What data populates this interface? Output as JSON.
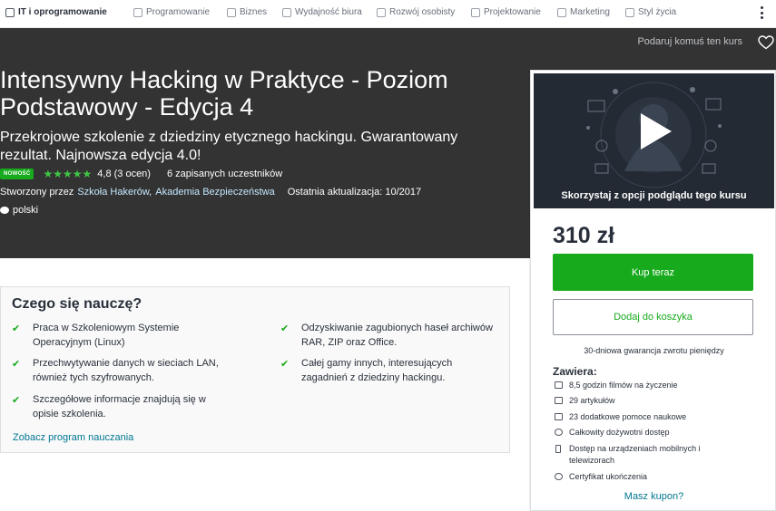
{
  "nav": {
    "home": "IT i oprogramowanie",
    "items": [
      "Programowanie",
      "Biznes",
      "Wydajność biura",
      "Rozwój osobisty",
      "Projektowanie",
      "Marketing",
      "Styl życia"
    ]
  },
  "hero": {
    "gift_label": "Podaruj komuś ten kurs",
    "title": "Intensywny Hacking w Praktyce - Poziom Podstawowy - Edycja 4",
    "subtitle": "Przekrojowe szkolenie z dziedziny etycznego hackingu. Gwarantowany rezultat. Najnowsza edycja 4.0!",
    "badge": "NOWOŚĆ",
    "stars": "★★★★★",
    "rating": "4,8 (3 ocen)",
    "rating_value": 4.8,
    "students": "6 zapisanych uczestników",
    "created_by_label": "Stworzony przez",
    "author1": "Szkoła Hakerów,",
    "author2": "Akademia Bezpieczeństwa",
    "last_update": "Ostatnia aktualizacja: 10/2017",
    "language": "polski"
  },
  "learn": {
    "title": "Czego się nauczę?",
    "items": [
      "Praca w Szkoleniowym Systemie Operacyjnym (Linux)",
      "Odzyskiwanie zagubionych haseł archiwów RAR, ZIP oraz Office.",
      "Przechwytywanie danych w sieciach LAN, również tych szyfrowanych.",
      "Całej gamy innych, interesujących zagadnień z dziedziny hackingu.",
      "Szczegółowe informacje znajdują się w opisie szkolenia."
    ],
    "curriculum_link": "Zobacz program nauczania"
  },
  "sidebar": {
    "preview_label": "Skorzystaj z opcji podglądu tego kursu",
    "price": "310 zł",
    "buy_label": "Kup teraz",
    "cart_label": "Dodaj do koszyka",
    "guarantee": "30-dniowa gwarancja zwrotu pieniędzy",
    "includes_title": "Zawiera:",
    "includes": [
      "8,5 godzin filmów na życzenie",
      "29 artykułów",
      "23 dodatkowe pomoce naukowe",
      "Całkowity dożywotni dostęp",
      "Dostęp na urządzeniach mobilnych i telewizorach",
      "Certyfikat ukończenia"
    ],
    "coupon": "Masz kupon?"
  },
  "colors": {
    "hero_bg": "#333333",
    "accent_green": "#17aa1c",
    "link_blue": "#007791"
  }
}
